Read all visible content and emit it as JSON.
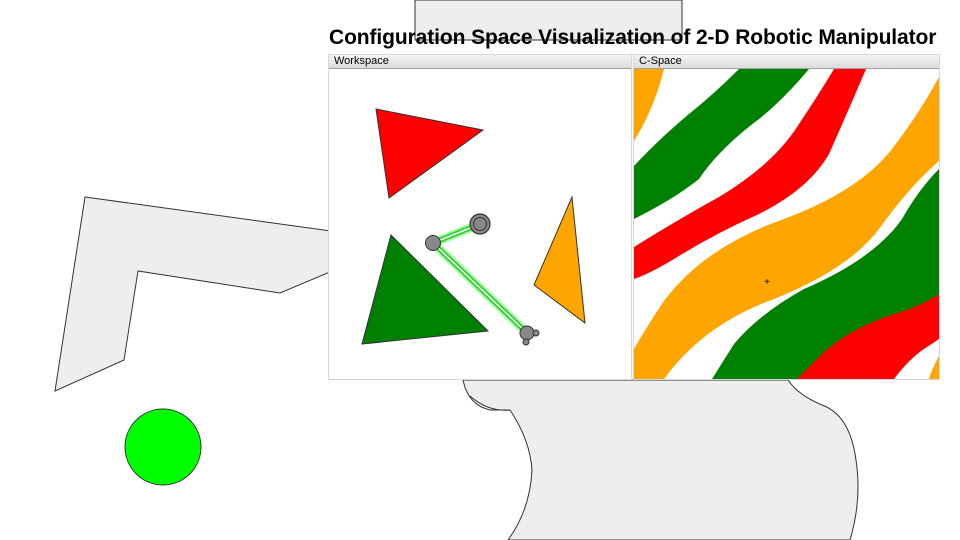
{
  "app": {
    "title": "Configuration Space Visualization of 2-D Robotic Manipulator"
  },
  "workspace_panel": {
    "label": "Workspace",
    "obstacles": [
      {
        "shape": "triangle",
        "color": "#ff0000"
      },
      {
        "shape": "triangle",
        "color": "#008000"
      },
      {
        "shape": "triangle",
        "color": "#ffa500"
      }
    ],
    "arm": {
      "link_color": "#44ee44",
      "joint_color": "#888888"
    }
  },
  "cspace_panel": {
    "label": "C-Space",
    "cursor_glyph": "+",
    "band_colors": {
      "red": "#ff0000",
      "green": "#008000",
      "orange": "#ffa500"
    }
  },
  "background": {
    "shape_fill": "#eeeeee",
    "goal_marker_color": "#00ff00"
  }
}
